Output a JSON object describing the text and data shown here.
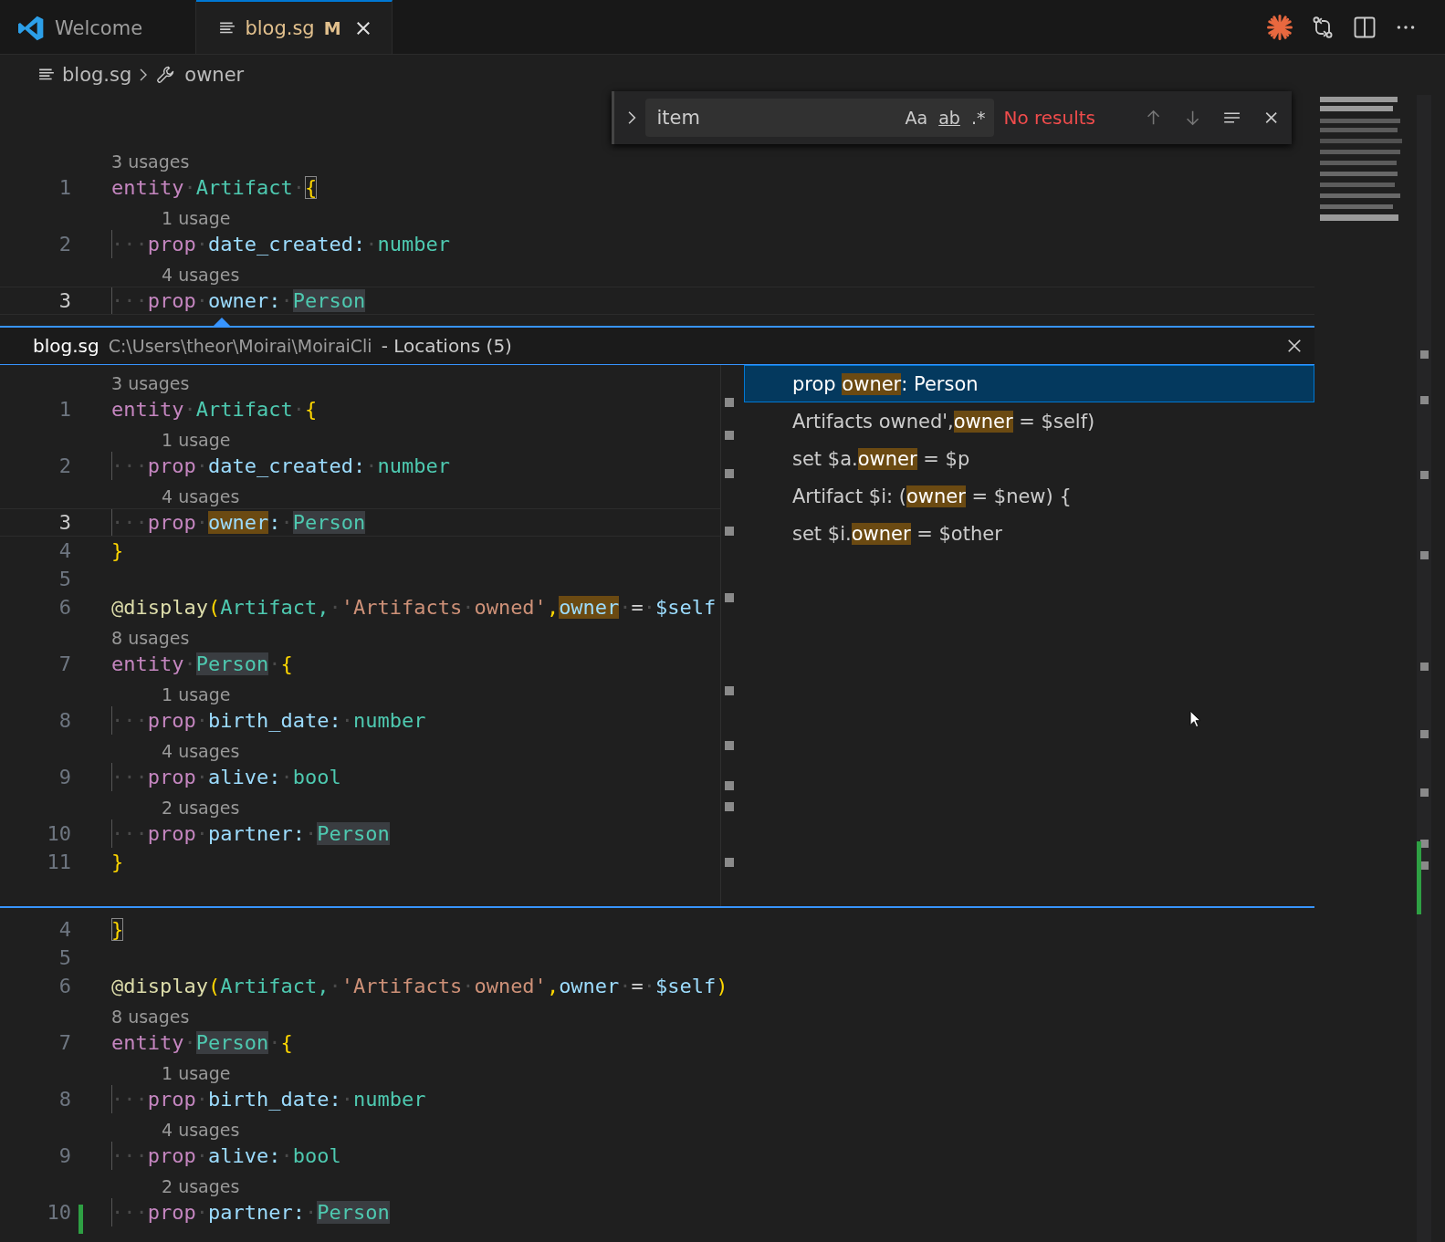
{
  "tabs": [
    {
      "label": "Welcome",
      "selected": false
    },
    {
      "label": "blog.sg",
      "selected": true,
      "badge": "M"
    }
  ],
  "breadcrumb": [
    {
      "label": "blog.sg"
    },
    {
      "label": "owner"
    }
  ],
  "find": {
    "value": "item",
    "options": [
      "Aa",
      "ab",
      ".*"
    ],
    "status": "No results"
  },
  "editor_top": [
    {
      "n": "1",
      "lens": "3 usages",
      "guide": false,
      "current": false,
      "tokens": [
        {
          "t": "entity",
          "kind": "kw"
        },
        {
          "t": "·",
          "kind": "ws"
        },
        {
          "t": "Artifact",
          "kind": "type"
        },
        {
          "t": "·",
          "kind": "ws"
        },
        {
          "t": "{",
          "kind": "brace",
          "highlighted": true
        }
      ]
    },
    {
      "n": "2",
      "lens": "1 usage",
      "guide": true,
      "current": false,
      "tokens": [
        {
          "t": "···",
          "kind": "ws"
        },
        {
          "t": "prop",
          "kind": "kw"
        },
        {
          "t": "·",
          "kind": "ws"
        },
        {
          "t": "date_created",
          "kind": "prop"
        },
        {
          "t": ":",
          "kind": "colon"
        },
        {
          "t": "·",
          "kind": "ws"
        },
        {
          "t": "number",
          "kind": "type"
        }
      ]
    },
    {
      "n": "3",
      "lens": "4 usages",
      "guide": true,
      "current": true,
      "tokens": [
        {
          "t": "···",
          "kind": "ws"
        },
        {
          "t": "prop",
          "kind": "kw"
        },
        {
          "t": "·",
          "kind": "ws"
        },
        {
          "t": "owner",
          "kind": "prop"
        },
        {
          "t": ":",
          "kind": "colon"
        },
        {
          "t": "·",
          "kind": "ws"
        },
        {
          "t": "Person",
          "kind": "type",
          "highlighted": true
        }
      ]
    }
  ],
  "peek": {
    "file": "blog.sg",
    "path": "C:\\Users\\theor\\Moirai\\MoiraiCli",
    "title": "- Locations (5)",
    "lines": [
      {
        "n": "1",
        "lens": "3 usages",
        "guide": false,
        "current": false,
        "tokens": [
          {
            "t": "entity",
            "kind": "kw"
          },
          {
            "t": "·",
            "kind": "ws"
          },
          {
            "t": "Artifact",
            "kind": "type"
          },
          {
            "t": "·",
            "kind": "ws"
          },
          {
            "t": "{",
            "kind": "brace"
          }
        ]
      },
      {
        "n": "2",
        "lens": "1 usage",
        "guide": true,
        "current": false,
        "tokens": [
          {
            "t": "···",
            "kind": "ws"
          },
          {
            "t": "prop",
            "kind": "kw"
          },
          {
            "t": "·",
            "kind": "ws"
          },
          {
            "t": "date_created",
            "kind": "prop"
          },
          {
            "t": ":",
            "kind": "colon"
          },
          {
            "t": "·",
            "kind": "ws"
          },
          {
            "t": "number",
            "kind": "type"
          }
        ]
      },
      {
        "n": "3",
        "lens": "4 usages",
        "guide": true,
        "current": true,
        "tokens": [
          {
            "t": "···",
            "kind": "ws"
          },
          {
            "t": "prop",
            "kind": "kw"
          },
          {
            "t": "·",
            "kind": "ws"
          },
          {
            "t": "owner",
            "kind": "prop",
            "highlighted": true
          },
          {
            "t": ":",
            "kind": "colon"
          },
          {
            "t": "·",
            "kind": "ws"
          },
          {
            "t": "Person",
            "kind": "type",
            "highlighted": true
          }
        ]
      },
      {
        "n": "4",
        "guide": false,
        "current": false,
        "tokens": [
          {
            "t": "}",
            "kind": "brace"
          }
        ]
      },
      {
        "n": "5",
        "guide": false,
        "current": false
      },
      {
        "n": "6",
        "guide": false,
        "current": false,
        "tokens": [
          {
            "t": "@display",
            "kind": "deco"
          },
          {
            "t": "(",
            "kind": "brace"
          },
          {
            "t": "Artifact,",
            "kind": "type"
          },
          {
            "t": "·",
            "kind": "ws"
          },
          {
            "t": "'Artifacts",
            "kind": "str"
          },
          {
            "t": "·",
            "kind": "ws"
          },
          {
            "t": "owned'",
            "kind": "str"
          },
          {
            "t": ",",
            "kind": "brace"
          },
          {
            "t": "owner",
            "kind": "prop",
            "highlighted": true
          },
          {
            "t": "·",
            "kind": "ws"
          },
          {
            "t": "=",
            "kind": "op"
          },
          {
            "t": "·",
            "kind": "ws"
          },
          {
            "t": "$self",
            "kind": "prop"
          }
        ]
      },
      {
        "n": "7",
        "lens": "8 usages",
        "guide": false,
        "current": false,
        "tokens": [
          {
            "t": "entity",
            "kind": "kw"
          },
          {
            "t": "·",
            "kind": "ws"
          },
          {
            "t": "Person",
            "kind": "type",
            "highlighted": true
          },
          {
            "t": "·",
            "kind": "ws"
          },
          {
            "t": "{",
            "kind": "brace"
          }
        ]
      },
      {
        "n": "8",
        "lens": "1 usage",
        "guide": true,
        "current": false,
        "tokens": [
          {
            "t": "···",
            "kind": "ws"
          },
          {
            "t": "prop",
            "kind": "kw"
          },
          {
            "t": "·",
            "kind": "ws"
          },
          {
            "t": "birth_date",
            "kind": "prop"
          },
          {
            "t": ":",
            "kind": "colon"
          },
          {
            "t": "·",
            "kind": "ws"
          },
          {
            "t": "number",
            "kind": "type"
          }
        ]
      },
      {
        "n": "9",
        "lens": "4 usages",
        "guide": true,
        "current": false,
        "tokens": [
          {
            "t": "···",
            "kind": "ws"
          },
          {
            "t": "prop",
            "kind": "kw"
          },
          {
            "t": "·",
            "kind": "ws"
          },
          {
            "t": "alive",
            "kind": "prop"
          },
          {
            "t": ":",
            "kind": "colon"
          },
          {
            "t": "·",
            "kind": "ws"
          },
          {
            "t": "bool",
            "kind": "type"
          }
        ]
      },
      {
        "n": "10",
        "lens": "2 usages",
        "guide": true,
        "current": false,
        "tokens": [
          {
            "t": "···",
            "kind": "ws"
          },
          {
            "t": "prop",
            "kind": "kw"
          },
          {
            "t": "·",
            "kind": "ws"
          },
          {
            "t": "partner",
            "kind": "prop"
          },
          {
            "t": ":",
            "kind": "colon"
          },
          {
            "t": "·",
            "kind": "ws"
          },
          {
            "t": "Person",
            "kind": "type",
            "highlighted": true
          }
        ]
      },
      {
        "n": "11",
        "guide": false,
        "current": false,
        "tokens": [
          {
            "t": "}",
            "kind": "brace"
          }
        ]
      }
    ],
    "references": [
      {
        "pre": "prop ",
        "match": "owner",
        "post": ": Person",
        "selected": true
      },
      {
        "pre": "Artifacts owned',",
        "match": "owner",
        "post": " = $self)",
        "selected": false
      },
      {
        "pre": "set $a.",
        "match": "owner",
        "post": " = $p",
        "selected": false
      },
      {
        "pre": "Artifact $i: (",
        "match": "owner",
        "post": " = $new) {",
        "selected": false
      },
      {
        "pre": "set $i.",
        "match": "owner",
        "post": " = $other",
        "selected": false
      }
    ]
  },
  "editor_bottom": [
    {
      "n": "4",
      "guide": false,
      "current": false,
      "tokens": [
        {
          "t": "}",
          "kind": "brace",
          "highlighted": true
        }
      ]
    },
    {
      "n": "5",
      "guide": false,
      "current": false
    },
    {
      "n": "6",
      "guide": false,
      "current": false,
      "tokens": [
        {
          "t": "@display",
          "kind": "deco"
        },
        {
          "t": "(",
          "kind": "brace"
        },
        {
          "t": "Artifact,",
          "kind": "type"
        },
        {
          "t": "·",
          "kind": "ws"
        },
        {
          "t": "'Artifacts",
          "kind": "str"
        },
        {
          "t": "·",
          "kind": "ws"
        },
        {
          "t": "owned'",
          "kind": "str"
        },
        {
          "t": ",",
          "kind": "brace"
        },
        {
          "t": "owner",
          "kind": "prop"
        },
        {
          "t": "·",
          "kind": "ws"
        },
        {
          "t": "=",
          "kind": "op"
        },
        {
          "t": "·",
          "kind": "ws"
        },
        {
          "t": "$self",
          "kind": "prop"
        },
        {
          "t": ")",
          "kind": "brace"
        }
      ]
    },
    {
      "n": "7",
      "lens": "8 usages",
      "guide": false,
      "current": false,
      "tokens": [
        {
          "t": "entity",
          "kind": "kw"
        },
        {
          "t": "·",
          "kind": "ws"
        },
        {
          "t": "Person",
          "kind": "type",
          "highlighted": true
        },
        {
          "t": "·",
          "kind": "ws"
        },
        {
          "t": "{",
          "kind": "brace"
        }
      ]
    },
    {
      "n": "8",
      "lens": "1 usage",
      "guide": true,
      "current": false,
      "tokens": [
        {
          "t": "···",
          "kind": "ws"
        },
        {
          "t": "prop",
          "kind": "kw"
        },
        {
          "t": "·",
          "kind": "ws"
        },
        {
          "t": "birth_date",
          "kind": "prop"
        },
        {
          "t": ":",
          "kind": "colon"
        },
        {
          "t": "·",
          "kind": "ws"
        },
        {
          "t": "number",
          "kind": "type"
        }
      ]
    },
    {
      "n": "9",
      "lens": "4 usages",
      "guide": true,
      "current": false,
      "tokens": [
        {
          "t": "···",
          "kind": "ws"
        },
        {
          "t": "prop",
          "kind": "kw"
        },
        {
          "t": "·",
          "kind": "ws"
        },
        {
          "t": "alive",
          "kind": "prop"
        },
        {
          "t": ":",
          "kind": "colon"
        },
        {
          "t": "·",
          "kind": "ws"
        },
        {
          "t": "bool",
          "kind": "type"
        }
      ]
    },
    {
      "n": "10",
      "lens": "2 usages",
      "guide": true,
      "current": false,
      "tokens": [
        {
          "t": "···",
          "kind": "ws"
        },
        {
          "t": "prop",
          "kind": "kw"
        },
        {
          "t": "·",
          "kind": "ws"
        },
        {
          "t": "partner",
          "kind": "prop"
        },
        {
          "t": ":",
          "kind": "colon"
        },
        {
          "t": "·",
          "kind": "ws"
        },
        {
          "t": "Person",
          "kind": "type",
          "highlighted": true
        }
      ]
    }
  ]
}
